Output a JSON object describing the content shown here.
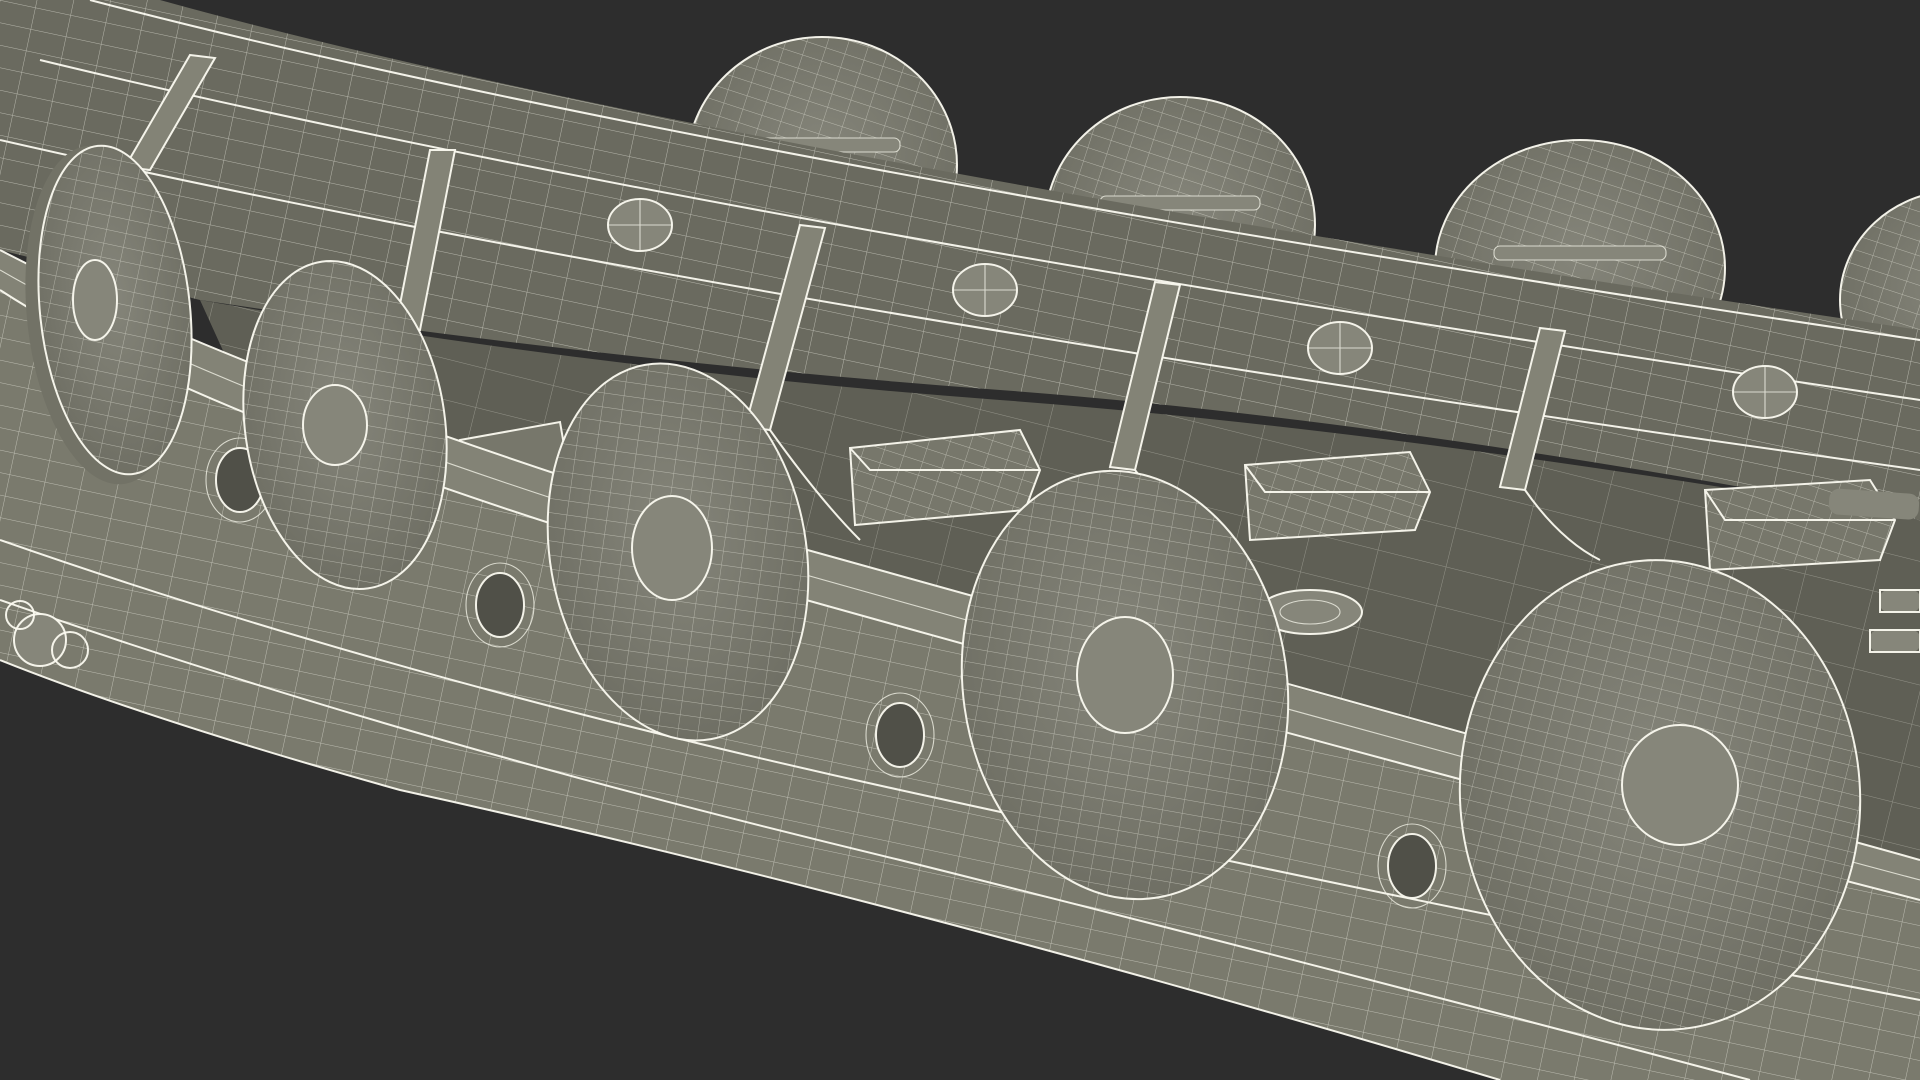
{
  "scene": {
    "subject": "viking-longship-wireframe",
    "render_style": "wireframe-over-shaded-clay",
    "colors": {
      "background": "#2d2d2d",
      "surface": "#7a7a6d",
      "surface_dark": "#5f5f55",
      "wire": "#f4f3e8"
    },
    "visible_parts": {
      "outer_shields": 5,
      "inner_shields": 4,
      "sea_chests": 4,
      "oar_holes": 5,
      "ribs": 5
    }
  }
}
